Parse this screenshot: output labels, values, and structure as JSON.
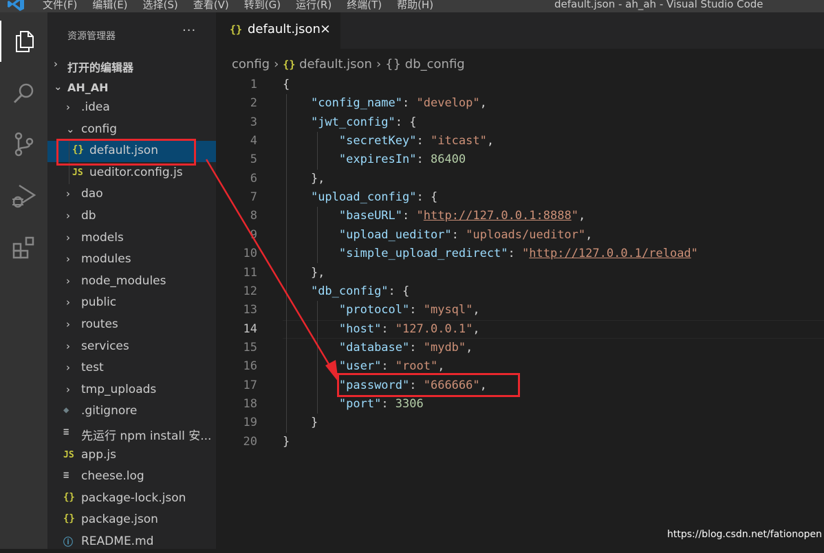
{
  "window": {
    "title": "default.json - ah_ah - Visual Studio Code",
    "menu": [
      "文件(F)",
      "编辑(E)",
      "选择(S)",
      "查看(V)",
      "转到(G)",
      "运行(R)",
      "终端(T)",
      "帮助(H)"
    ]
  },
  "activity_bar": [
    {
      "icon": "files-icon",
      "active": true
    },
    {
      "icon": "search-icon",
      "active": false
    },
    {
      "icon": "source-control-icon",
      "active": false
    },
    {
      "icon": "run-debug-icon",
      "active": false
    },
    {
      "icon": "extensions-icon",
      "active": false
    }
  ],
  "explorer": {
    "title": "资源管理器",
    "more": "···",
    "open_editors": "打开的编辑器",
    "root": "AH_AH",
    "items": [
      {
        "label": ".idea",
        "type": "folder",
        "chev": "›"
      },
      {
        "label": "config",
        "type": "folder-open",
        "chev": "⌄"
      },
      {
        "label": "default.json",
        "type": "json",
        "icon_text": "{}"
      },
      {
        "label": "ueditor.config.js",
        "type": "js",
        "icon_text": "JS"
      },
      {
        "label": "dao",
        "type": "folder",
        "chev": "›"
      },
      {
        "label": "db",
        "type": "folder",
        "chev": "›"
      },
      {
        "label": "models",
        "type": "folder",
        "chev": "›"
      },
      {
        "label": "modules",
        "type": "folder",
        "chev": "›"
      },
      {
        "label": "node_modules",
        "type": "folder",
        "chev": "›"
      },
      {
        "label": "public",
        "type": "folder",
        "chev": "›"
      },
      {
        "label": "routes",
        "type": "folder",
        "chev": "›"
      },
      {
        "label": "services",
        "type": "folder",
        "chev": "›"
      },
      {
        "label": "test",
        "type": "folder",
        "chev": "›"
      },
      {
        "label": "tmp_uploads",
        "type": "folder",
        "chev": "›"
      },
      {
        "label": ".gitignore",
        "type": "git",
        "icon_text": "◆"
      },
      {
        "label": "先运行 npm install 安...",
        "type": "text",
        "icon_text": "≡"
      },
      {
        "label": "app.js",
        "type": "js",
        "icon_text": "JS"
      },
      {
        "label": "cheese.log",
        "type": "text",
        "icon_text": "≡"
      },
      {
        "label": "package-lock.json",
        "type": "json",
        "icon_text": "{}"
      },
      {
        "label": "package.json",
        "type": "json",
        "icon_text": "{}"
      },
      {
        "label": "README.md",
        "type": "info",
        "icon_text": "ⓘ"
      }
    ]
  },
  "editor": {
    "tab": {
      "label": "default.json",
      "icon_text": "{}",
      "close": "×"
    },
    "breadcrumb": {
      "folder": "config",
      "file": "default.json",
      "symbol_icon": "{}",
      "symbol": "db_config",
      "file_icon": "{}",
      "sep": "›"
    },
    "current_line": 14,
    "lines": [
      "{",
      "    \"config_name\": \"develop\",",
      "    \"jwt_config\": {",
      "        \"secretKey\": \"itcast\",",
      "        \"expiresIn\": 86400",
      "    },",
      "    \"upload_config\": {",
      "        \"baseURL\": \"http://127.0.0.1:8888\",",
      "        \"upload_ueditor\": \"uploads/ueditor\",",
      "        \"simple_upload_redirect\": \"http://127.0.0.1/reload\"",
      "    },",
      "    \"db_config\": {",
      "        \"protocol\": \"mysql\",",
      "        \"host\": \"127.0.0.1\",",
      "        \"database\": \"mydb\",",
      "        \"user\": \"root\",",
      "        \"password\": \"666666\",",
      "        \"port\": 3306",
      "    }",
      "}"
    ]
  },
  "watermark": "https://blog.csdn.net/fationopen",
  "colors": {
    "annotation": "#e8272d",
    "selection": "#094771",
    "key": "#9cdcfe",
    "string": "#ce9178",
    "number": "#b5cea8"
  }
}
